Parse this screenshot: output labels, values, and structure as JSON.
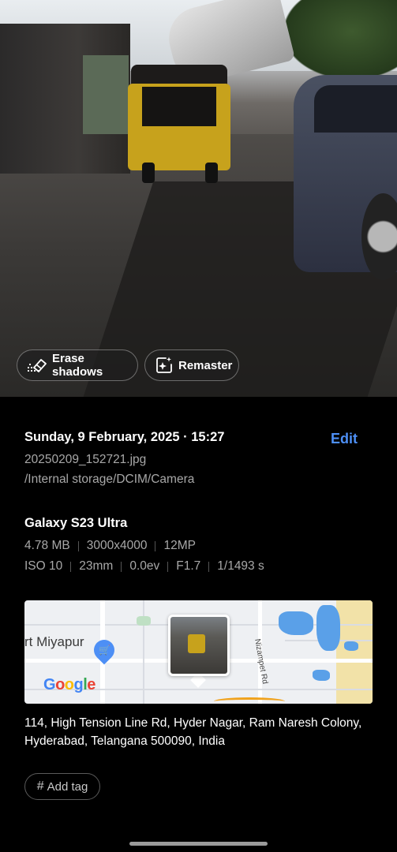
{
  "photo": {
    "actions": {
      "erase_shadows": {
        "label": "Erase shadows",
        "icon": "erase-shadows-icon"
      },
      "remaster": {
        "label": "Remaster",
        "icon": "remaster-sparkle-icon"
      }
    }
  },
  "details": {
    "datetime": "Sunday, 9 February, 2025 · 15:27",
    "edit_label": "Edit",
    "filename": "20250209_152721.jpg",
    "path": "/Internal storage/DCIM/Camera",
    "device": "Galaxy S23 Ultra",
    "specs_row1": [
      "4.78 MB",
      "3000x4000",
      "12MP"
    ],
    "specs_row2": [
      "ISO 10",
      "23mm",
      "0.0ev",
      "F1.7",
      "1/1493 s"
    ]
  },
  "map": {
    "place_label": "rt Miyapur",
    "road_label": "Nizampet Rd",
    "attribution": "Google"
  },
  "address": "114, High Tension Line Rd, Hyder Nagar, Ram Naresh Colony, Hyderabad, Telangana 500090, India",
  "tag": {
    "label": "Add tag",
    "icon": "hash-icon"
  },
  "colors": {
    "accent": "#4d8ff5",
    "background": "#000000",
    "secondary_text": "#a8a8a8"
  }
}
